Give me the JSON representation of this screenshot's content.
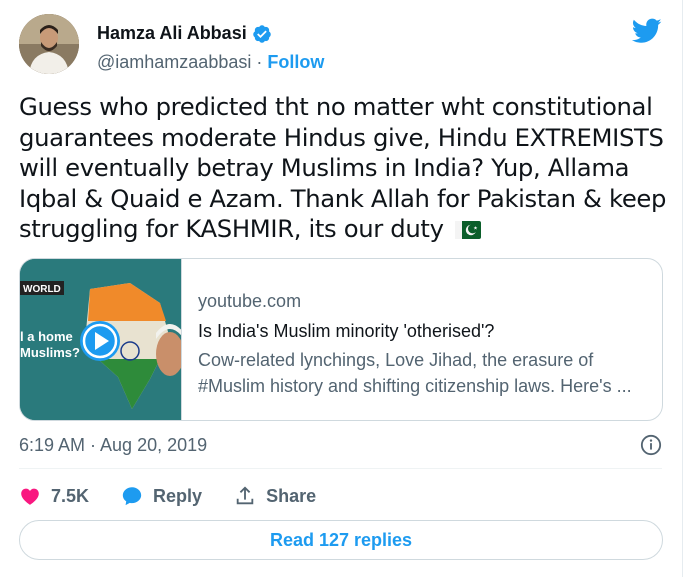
{
  "author": {
    "name": "Hamza Ali Abbasi",
    "handle": "@iamhamzaabbasi",
    "separator": "·",
    "follow_label": "Follow"
  },
  "tweet": {
    "text": "Guess who predicted tht no matter wht constitutional guarantees moderate Hindus give, Hindu EXTREMISTS will eventually betray Muslims in India? Yup, Allama Iqbal & Quaid e Azam. Thank Allah for Pakistan & keep struggling for KASHMIR, its our duty",
    "flag_icon": "pakistan-flag-emoji"
  },
  "link_card": {
    "domain": "youtube.com",
    "title": "Is India's Muslim minority 'otherised'?",
    "description": "Cow-related lynchings, Love Jihad, the erasure of #Muslim history and shifting citizenship laws. Here's ...",
    "thumb_logo": "WORLD",
    "thumb_text_line1": "l a home",
    "thumb_text_line2": "Muslims?"
  },
  "meta": {
    "timestamp": "6:19 AM · Aug 20, 2019"
  },
  "actions": {
    "likes_count": "7.5K",
    "reply_label": "Reply",
    "share_label": "Share"
  },
  "read_replies_label": "Read 127 replies",
  "colors": {
    "brand_blue": "#1d9bf0",
    "like_pink": "#f91880",
    "text_primary": "#0f1419",
    "text_secondary": "#536471"
  }
}
